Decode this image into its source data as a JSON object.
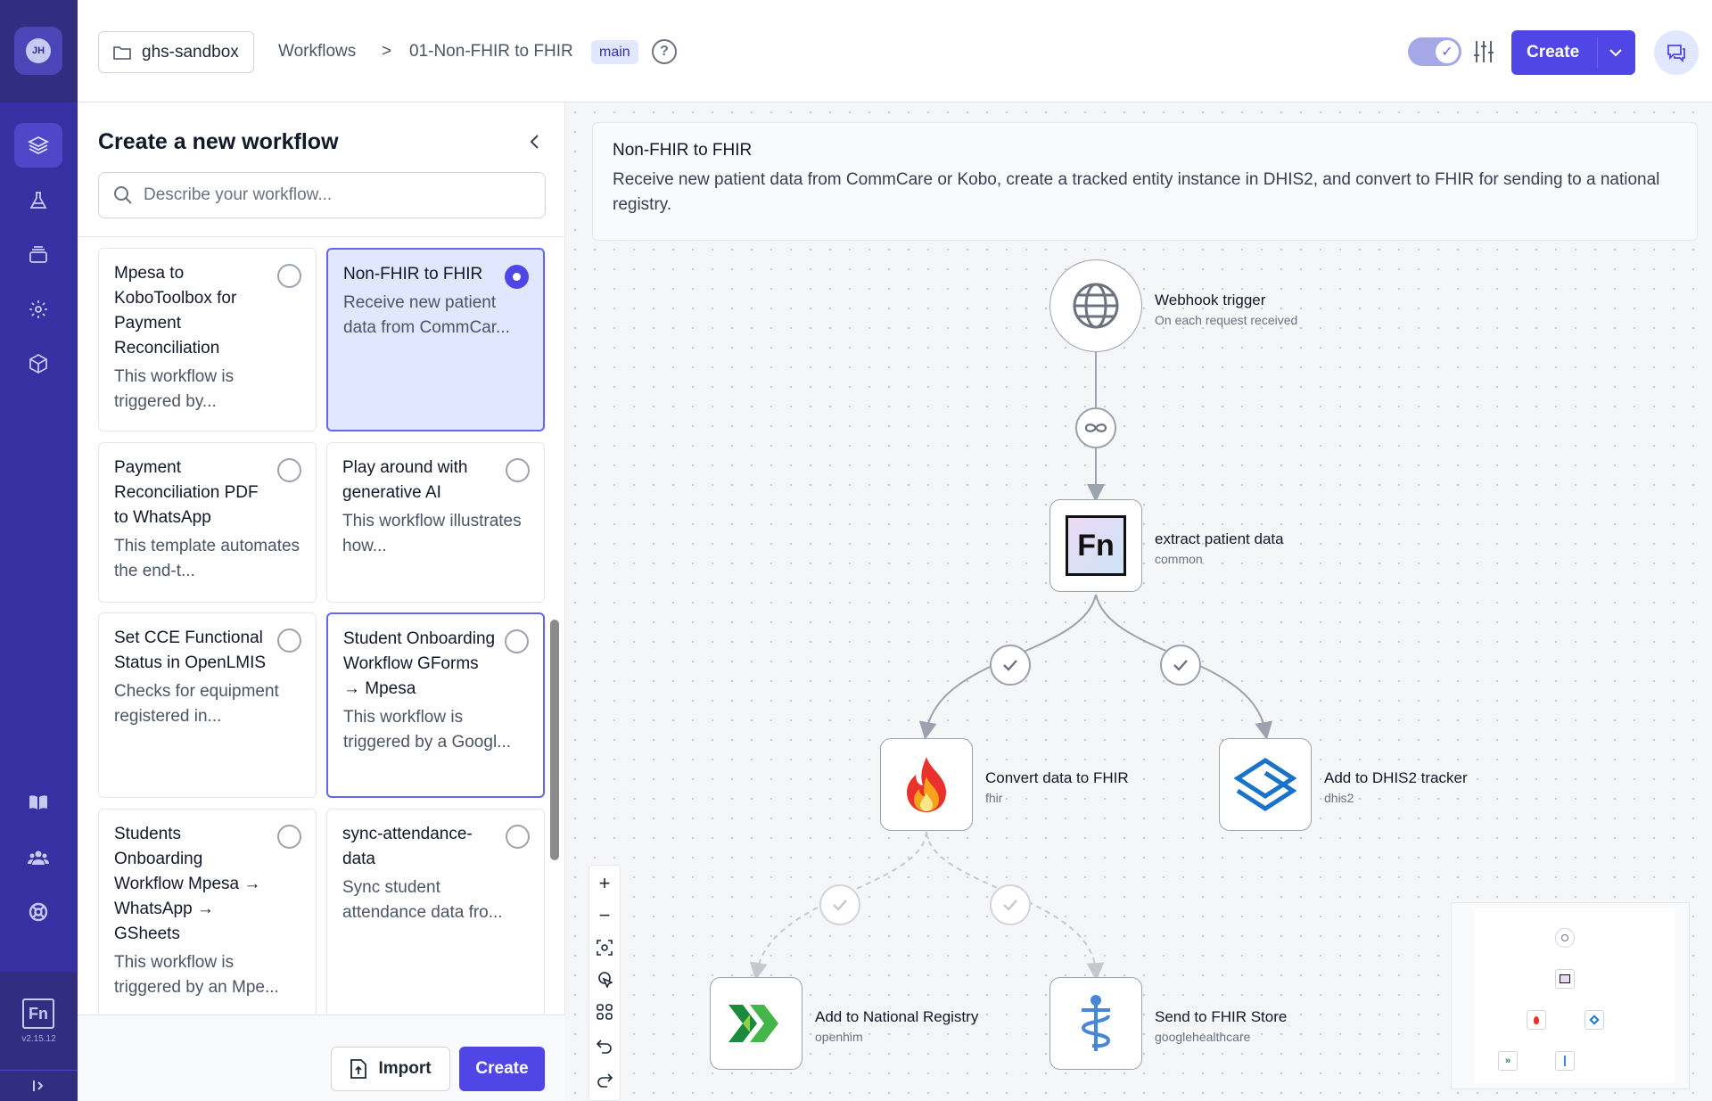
{
  "nav": {
    "avatar_initials": "JH",
    "version": "v2.15.12",
    "logo_text": "Fn",
    "icons": [
      "layers-icon",
      "flask-icon",
      "archive-icon",
      "gear-icon",
      "cube-icon",
      "book-icon",
      "users-icon",
      "lifebuoy-icon"
    ]
  },
  "header": {
    "project": "ghs-sandbox",
    "breadcrumb_workflows": "Workflows",
    "breadcrumb_separator": ">",
    "workflow_name": "01-Non-FHIR to FHIR",
    "branch": "main",
    "help_label": "?",
    "create_label": "Create"
  },
  "panel": {
    "title": "Create a new workflow",
    "search_placeholder": "Describe your workflow...",
    "import_label": "Import",
    "create_label": "Create",
    "templates": [
      {
        "title": "Mpesa to KoboToolbox for Payment Reconciliation",
        "desc": "This workflow is triggered by..."
      },
      {
        "title": "Non-FHIR to FHIR",
        "desc": "Receive new patient data from CommCar...",
        "selected": true
      },
      {
        "title": "Payment Reconciliation PDF to WhatsApp",
        "desc": "This template automates the end-t..."
      },
      {
        "title": "Play around with generative AI",
        "desc": "This workflow illustrates how..."
      },
      {
        "title": "Set CCE Functional Status in OpenLMIS",
        "desc": "Checks for equipment registered in..."
      },
      {
        "title": "Student Onboarding Workflow GForms → Mpesa",
        "desc": "This workflow is triggered by a Googl..."
      },
      {
        "title": "Students Onboarding Workflow Mpesa → WhatsApp → GSheets",
        "desc": "This workflow is triggered by an Mpe..."
      },
      {
        "title": "sync-attendance-data",
        "desc": "Sync student attendance data fro..."
      }
    ]
  },
  "canvas": {
    "info_title": "Non-FHIR to FHIR",
    "info_desc": "Receive new patient data from CommCare or Kobo, create a tracked entity instance in DHIS2, and convert to FHIR for sending to a national registry.",
    "nodes": [
      {
        "label": "Webhook trigger",
        "sub": "On each request received",
        "icon": "globe-icon"
      },
      {
        "label": "extract patient data",
        "sub": "common",
        "icon": "fn-icon"
      },
      {
        "label": "Convert data to FHIR",
        "sub": "fhir",
        "icon": "fire-icon"
      },
      {
        "label": "Add to DHIS2 tracker",
        "sub": "dhis2",
        "icon": "dhis2-icon"
      },
      {
        "label": "Add to National Registry",
        "sub": "openhim",
        "icon": "openhim-icon"
      },
      {
        "label": "Send to FHIR Store",
        "sub": "googlehealthcare",
        "icon": "caduceus-icon"
      }
    ],
    "fn_text": "Fn",
    "controls": [
      "zoom-in",
      "zoom-out",
      "fit-view",
      "pointer-mode",
      "auto-layout",
      "undo",
      "redo"
    ]
  },
  "colors": {
    "accent": "#4f46e5",
    "nav_bg": "#3730a3",
    "selected_card_bg": "#e0e7ff"
  }
}
